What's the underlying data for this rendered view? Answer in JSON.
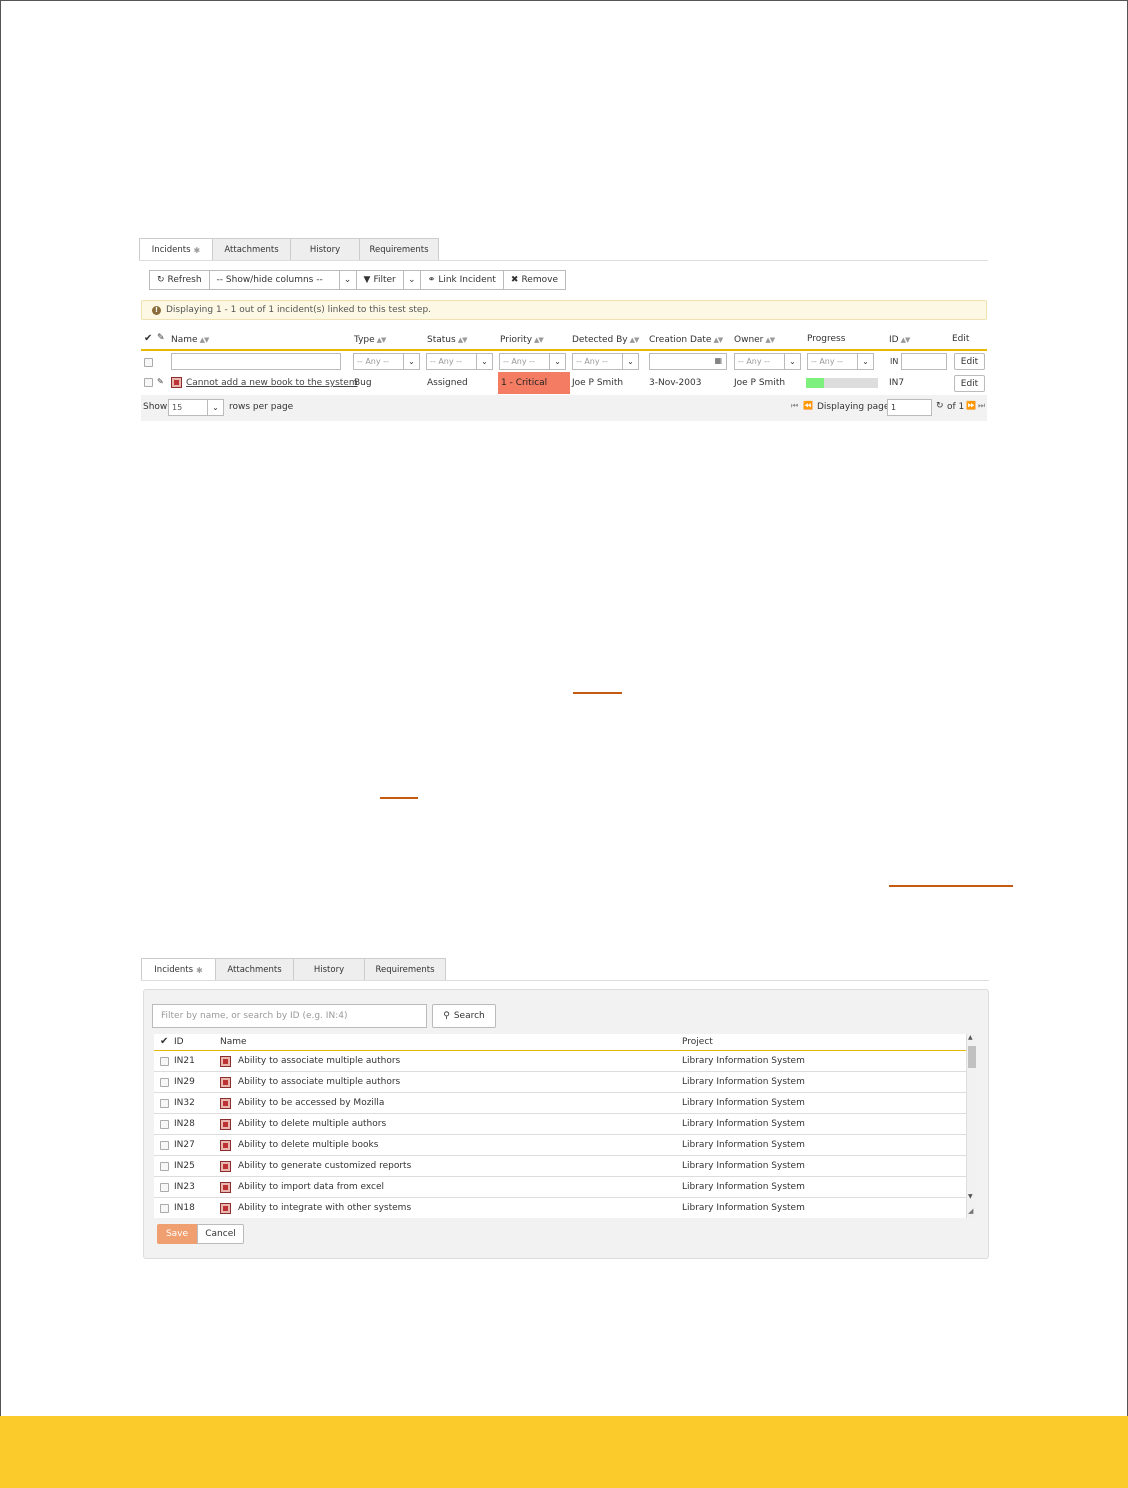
{
  "screen1": {
    "tabs": [
      "Incidents",
      "Attachments",
      "History",
      "Requirements"
    ],
    "tab_marker": "✱",
    "toolbar": {
      "refresh": "Refresh",
      "show_hide": "-- Show/hide columns --",
      "filter": "Filter",
      "link_incident": "Link Incident",
      "remove": "Remove"
    },
    "info": "Displaying 1 - 1 out of 1 incident(s) linked to this test step.",
    "columns": {
      "name": "Name",
      "type": "Type",
      "status": "Status",
      "priority": "Priority",
      "detected_by": "Detected By",
      "creation_date": "Creation Date",
      "owner": "Owner",
      "progress": "Progress",
      "id": "ID",
      "edit": "Edit"
    },
    "filters": {
      "any": "-- Any --",
      "id_prefix": "IN",
      "edit_button": "Edit"
    },
    "row": {
      "name": "Cannot add a new book to the system",
      "type": "Bug",
      "status": "Assigned",
      "priority": "1 - Critical",
      "detected_by": "Joe P Smith",
      "creation_date": "3-Nov-2003",
      "owner": "Joe P Smith",
      "progress_fraction": 0.25,
      "id": "IN7",
      "edit_button": "Edit"
    },
    "pager": {
      "show": "Show",
      "rows_value": "15",
      "rows_per_page": "rows per page",
      "displaying_page": "Displaying page",
      "page_value": "1",
      "of": "of 1"
    },
    "colors": {
      "priority_critical": "#f47c62",
      "progress_fill": "#7ef07e",
      "header_rule": "#e8b800"
    }
  },
  "screen2": {
    "tabs": [
      "Incidents",
      "Attachments",
      "History",
      "Requirements"
    ],
    "tab_marker": "✱",
    "search": {
      "placeholder": "Filter by name, or search by ID (e.g. IN:4)",
      "button": "Search"
    },
    "columns": {
      "id": "ID",
      "name": "Name",
      "project": "Project"
    },
    "rows": [
      {
        "id": "IN21",
        "name": "Ability to associate multiple authors",
        "project": "Library Information System"
      },
      {
        "id": "IN29",
        "name": "Ability to associate multiple authors",
        "project": "Library Information System"
      },
      {
        "id": "IN32",
        "name": "Ability to be accessed by Mozilla",
        "project": "Library Information System"
      },
      {
        "id": "IN28",
        "name": "Ability to delete multiple authors",
        "project": "Library Information System"
      },
      {
        "id": "IN27",
        "name": "Ability to delete multiple books",
        "project": "Library Information System"
      },
      {
        "id": "IN25",
        "name": "Ability to generate customized reports",
        "project": "Library Information System"
      },
      {
        "id": "IN23",
        "name": "Ability to import data from excel",
        "project": "Library Information System"
      },
      {
        "id": "IN18",
        "name": "Ability to integrate with other systems",
        "project": "Library Information System"
      }
    ],
    "actions": {
      "save": "Save",
      "cancel": "Cancel"
    },
    "colors": {
      "save": "#f0a070"
    }
  },
  "page": {
    "colors": {
      "footer": "#fbcb2b",
      "link_underline": "#c55a11"
    }
  }
}
